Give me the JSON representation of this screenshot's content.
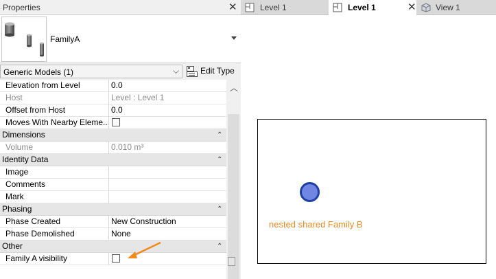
{
  "properties_panel": {
    "title": "Properties",
    "close_glyph": "✕",
    "type_selector": {
      "type_name": "FamilyA",
      "thumbnail_icon": "cylinders-family-thumbnail"
    },
    "category_filter": {
      "label": "Generic Models (1)",
      "chevron": "⌵"
    },
    "edit_type": {
      "label": "Edit Type",
      "icon": "edit-type-icon"
    },
    "collapse_glyph": "⌃",
    "rows": {
      "elevation_from_level": {
        "name": "Elevation from Level",
        "value": "0.0"
      },
      "host": {
        "name": "Host",
        "value": "Level : Level 1"
      },
      "offset_from_host": {
        "name": "Offset from Host",
        "value": "0.0"
      },
      "moves_with_nearby": {
        "name": "Moves With Nearby Eleme...",
        "checked": false
      },
      "volume": {
        "name": "Volume",
        "value": "0.010 m³"
      },
      "image": {
        "name": "Image",
        "value": ""
      },
      "comments": {
        "name": "Comments",
        "value": ""
      },
      "mark": {
        "name": "Mark",
        "value": ""
      },
      "phase_created": {
        "name": "Phase Created",
        "value": "New Construction"
      },
      "phase_demolished": {
        "name": "Phase Demolished",
        "value": "None"
      },
      "family_a_visibility": {
        "name": "Family A visibility",
        "checked": false
      }
    },
    "groups": {
      "dimensions": "Dimensions",
      "identity_data": "Identity Data",
      "phasing": "Phasing",
      "other": "Other"
    }
  },
  "tabs": [
    {
      "label": "Level 1",
      "icon": "floor-plan-icon",
      "active": false
    },
    {
      "label": "Level 1",
      "icon": "floor-plan-icon",
      "active": true
    },
    {
      "label": "View 1",
      "icon": "3d-view-icon",
      "active": false
    }
  ],
  "tab_close_glyph": "✕",
  "canvas": {
    "annotation": "nested shared Family B"
  },
  "colors": {
    "annotation_text": "#ef8a23",
    "arrow": "#f08a1c",
    "marker_fill": "#6f86e3",
    "marker_stroke": "#1f3fa8"
  }
}
